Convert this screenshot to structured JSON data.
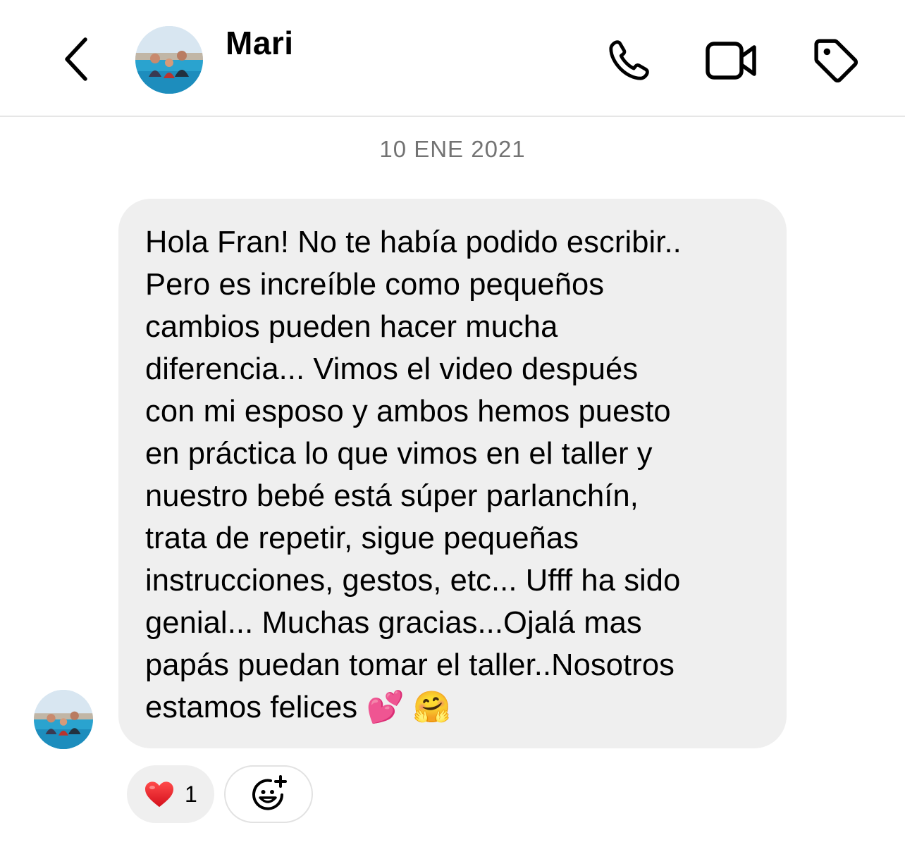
{
  "header": {
    "contact_name": "Mari",
    "icons": {
      "back": "chevron-left-icon",
      "call": "phone-icon",
      "video": "video-camera-icon",
      "tag": "tag-icon"
    }
  },
  "thread": {
    "date": "10 ENE 2021",
    "message": {
      "text": "Hola Fran! No te había podido escribir..\nPero es increíble como pequeños\ncambios pueden hacer mucha\ndiferencia... Vimos el video después\ncon mi esposo y ambos hemos puesto\nen práctica lo que vimos en el taller y\nnuestro bebé está súper parlanchín,\ntrata de repetir, sigue pequeñas\ninstrucciones, gestos, etc... Ufff ha sido\ngenial... Muchas gracias...Ojalá mas\npapás puedan tomar el taller..Nosotros\nestamos felices 💕 🤗",
      "reactions": [
        {
          "icon": "heart-icon",
          "count": "1"
        }
      ],
      "add_reaction_icon": "add-emoji-icon"
    }
  },
  "colors": {
    "bubble_bg": "#efefef",
    "divider": "#e6e6e6",
    "date_text": "#737373",
    "heart": "#e8202a"
  }
}
